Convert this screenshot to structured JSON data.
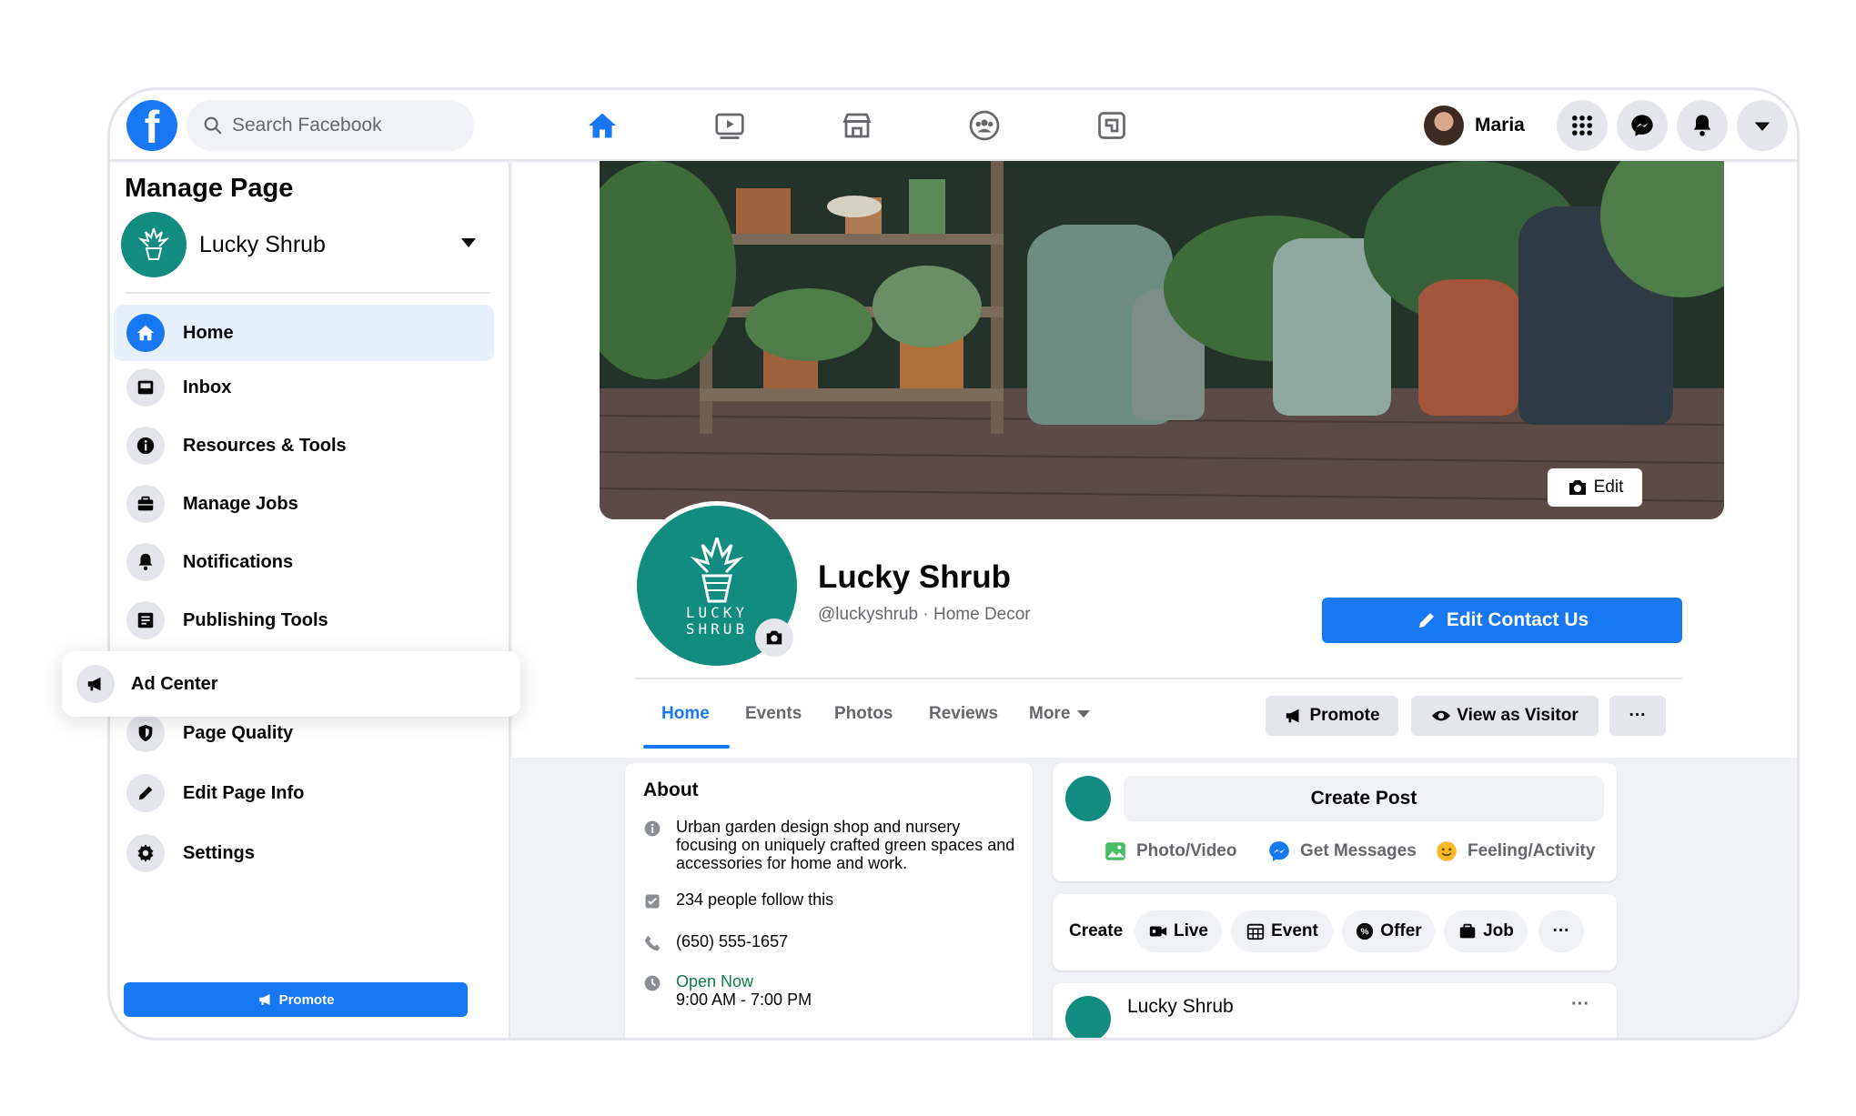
{
  "topbar": {
    "logo_letter": "f",
    "search_placeholder": "Search Facebook",
    "nav_tabs": [
      "home-icon",
      "watch-icon",
      "marketplace-icon",
      "groups-icon",
      "gaming-icon"
    ],
    "user_name": "Maria"
  },
  "sidebar": {
    "title": "Manage Page",
    "page_name": "Lucky Shrub",
    "items": [
      {
        "label": "Home",
        "icon": "home-icon",
        "active": true
      },
      {
        "label": "Inbox",
        "icon": "inbox-icon"
      },
      {
        "label": "Resources & Tools",
        "icon": "info-icon"
      },
      {
        "label": "Manage Jobs",
        "icon": "briefcase-icon"
      },
      {
        "label": "Notifications",
        "icon": "bell-icon"
      },
      {
        "label": "Publishing Tools",
        "icon": "publishing-icon"
      },
      {
        "label": "Ad Center",
        "icon": "megaphone-icon",
        "highlighted": true
      },
      {
        "label": "Page Quality",
        "icon": "shield-icon"
      },
      {
        "label": "Edit Page Info",
        "icon": "pencil-icon"
      },
      {
        "label": "Settings",
        "icon": "gear-icon"
      }
    ],
    "promote_label": "Promote"
  },
  "page_header": {
    "cover_edit_label": "Edit",
    "avatar_wordmark": [
      "LUCKY",
      "SHRUB"
    ],
    "name": "Lucky Shrub",
    "handle": "@luckyshrub · Home Decor",
    "edit_contact_label": "Edit Contact Us",
    "tabs": [
      "Home",
      "Events",
      "Photos",
      "Reviews",
      "More"
    ],
    "promote_label": "Promote",
    "view_as_visitor_label": "View as Visitor",
    "more_label": "···"
  },
  "about": {
    "title": "About",
    "description": "Urban garden design shop and nursery focusing on uniquely crafted green spaces and accessories for home and work.",
    "followers": "234 people follow this",
    "phone": "(650) 555-1657",
    "open_status": "Open Now",
    "hours": "9:00 AM - 7:00 PM"
  },
  "create_post": {
    "label": "Create Post",
    "actions": [
      "Photo/Video",
      "Get Messages",
      "Feeling/Activity"
    ]
  },
  "create_bar": {
    "label": "Create",
    "chips": [
      "Live",
      "Event",
      "Offer",
      "Job"
    ],
    "more_label": "···"
  },
  "feed_post": {
    "author": "Lucky Shrub",
    "menu_label": "···"
  },
  "colors": {
    "brand": "#1877f2",
    "page_green": "#128c7e",
    "open_green": "#0f7b4a"
  }
}
